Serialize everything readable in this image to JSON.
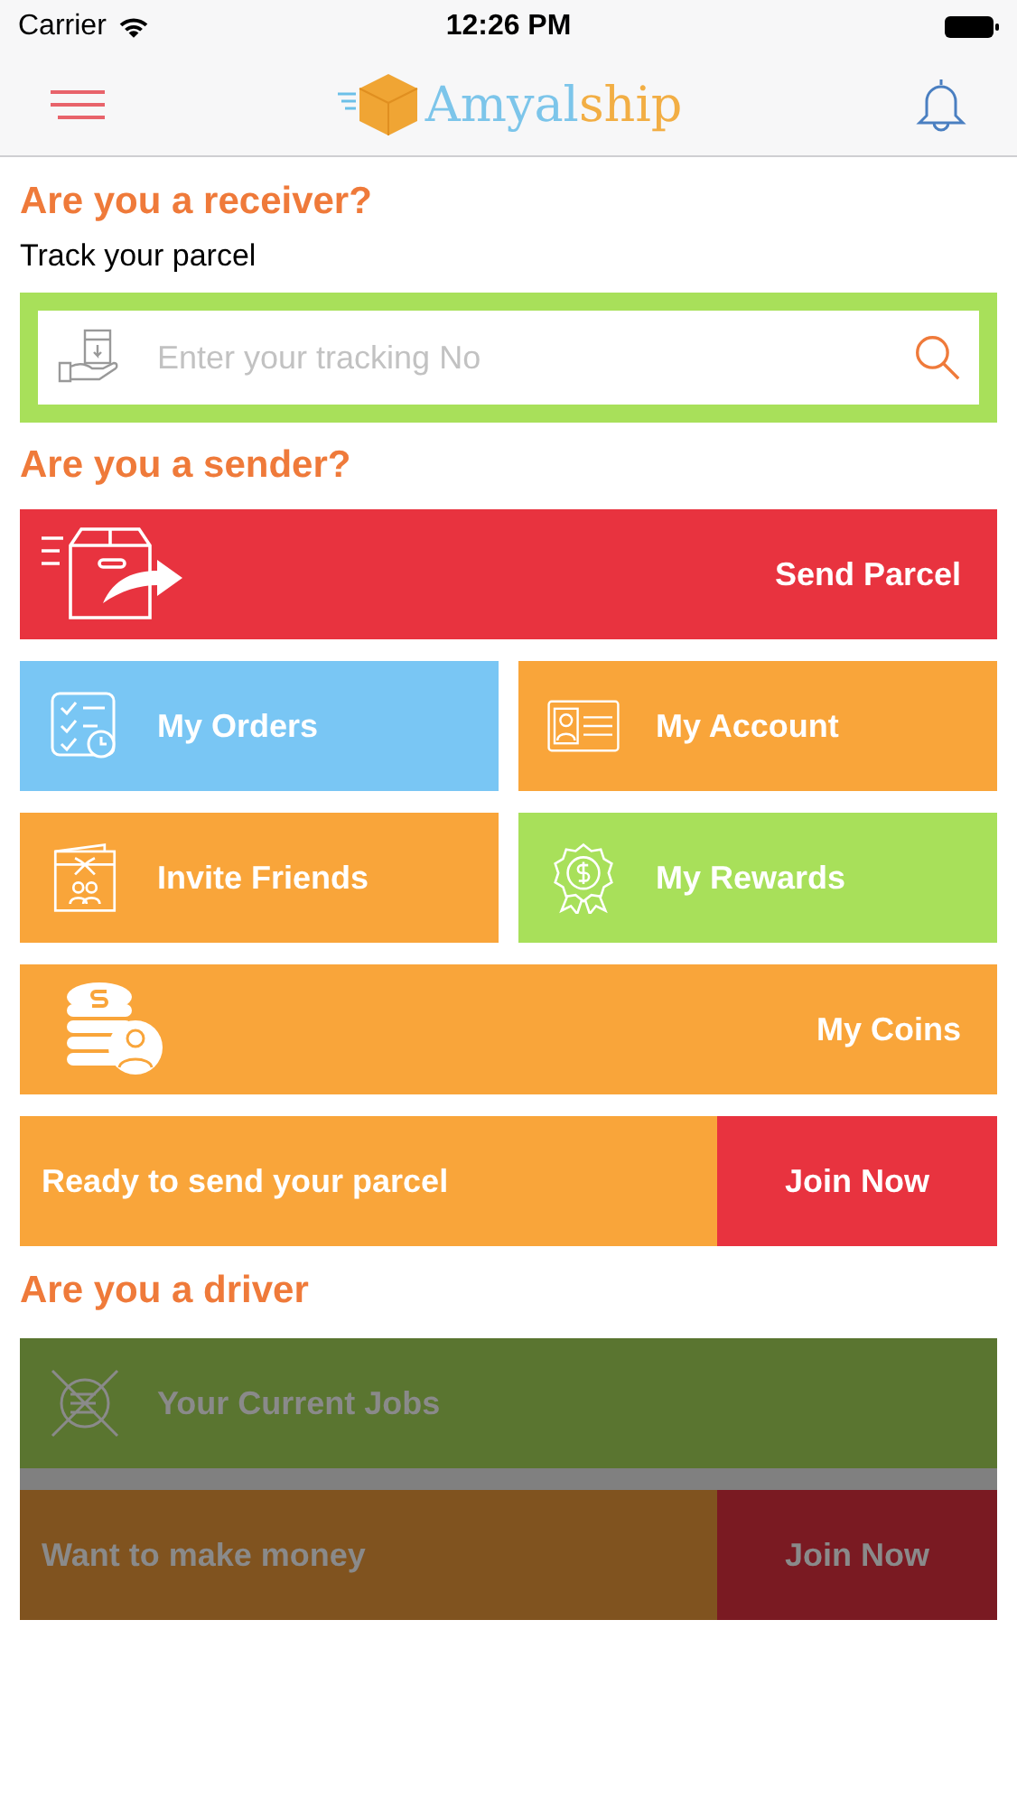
{
  "status_bar": {
    "carrier": "Carrier",
    "time": "12:26 PM"
  },
  "nav": {
    "logo_first": "Amyal",
    "logo_second": "ship"
  },
  "receiver": {
    "heading": "Are you a receiver?",
    "subtitle": "Track your parcel",
    "search": {
      "placeholder": "Enter your tracking No"
    }
  },
  "sender": {
    "heading": "Are you a sender?",
    "tiles": [
      {
        "kind": "wide",
        "label": "Send Parcel",
        "color": "#e8333f"
      },
      {
        "kind": "half",
        "label": "My Orders",
        "color": "#79c6f4"
      },
      {
        "kind": "half",
        "label": "My Account",
        "color": "#f9a53a"
      },
      {
        "kind": "half",
        "label": "Invite Friends",
        "color": "#f9a53a"
      },
      {
        "kind": "half",
        "label": "My Rewards",
        "color": "#a8e05a"
      },
      {
        "kind": "wide",
        "label": "My Coins",
        "color": "#f9a53a"
      },
      {
        "kind": "split",
        "label": "Ready to send your parcel",
        "color": "#f9a53a",
        "button": {
          "label": "Join Now",
          "color": "#e8333f"
        }
      }
    ]
  },
  "driver": {
    "heading": "Are you a driver",
    "disabled": true,
    "tiles": [
      {
        "kind": "row",
        "label": "Your Current Jobs",
        "color": "#5a7530"
      },
      {
        "kind": "split",
        "label": "Want to make money",
        "color": "#80531f",
        "button": {
          "label": "Join Now",
          "color": "#7a1a22"
        }
      }
    ]
  }
}
